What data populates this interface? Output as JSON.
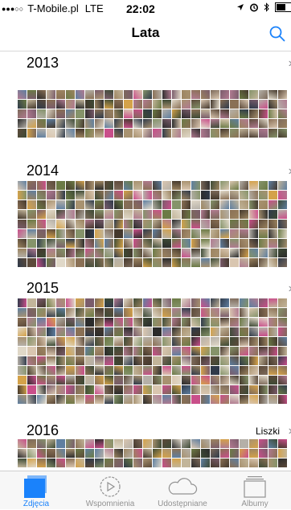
{
  "status_bar": {
    "carrier": "T-Mobile.pl",
    "network": "LTE",
    "time": "22:02"
  },
  "nav": {
    "title": "Lata",
    "search_icon": "search-icon"
  },
  "years": [
    {
      "year": "2013",
      "location": ""
    },
    {
      "year": "2014",
      "location": ""
    },
    {
      "year": "2015",
      "location": ""
    },
    {
      "year": "2016",
      "location": "Liszki"
    }
  ],
  "tabs": [
    {
      "label": "Zdjęcia",
      "icon": "photos-icon",
      "active": true
    },
    {
      "label": "Wspomnienia",
      "icon": "memories-icon",
      "active": false
    },
    {
      "label": "Udostępniane",
      "icon": "shared-cloud-icon",
      "active": false
    },
    {
      "label": "Albumy",
      "icon": "albums-icon",
      "active": false
    }
  ],
  "colors": {
    "accent": "#1a82fb",
    "tab_inactive": "#929292",
    "thumbnail_palette": [
      "#5c4a3a",
      "#8a7055",
      "#a89270",
      "#3d4a35",
      "#6b7a45",
      "#c2b59a",
      "#d9c6b0",
      "#2f3a4a",
      "#7a5c6b",
      "#b07a90",
      "#c94f8a",
      "#5f7fa0",
      "#e0d8c8",
      "#9c8460",
      "#44382c",
      "#85936a",
      "#d4a24a",
      "#2b2b2b",
      "#b5b0a8",
      "#7d6a5a"
    ]
  }
}
